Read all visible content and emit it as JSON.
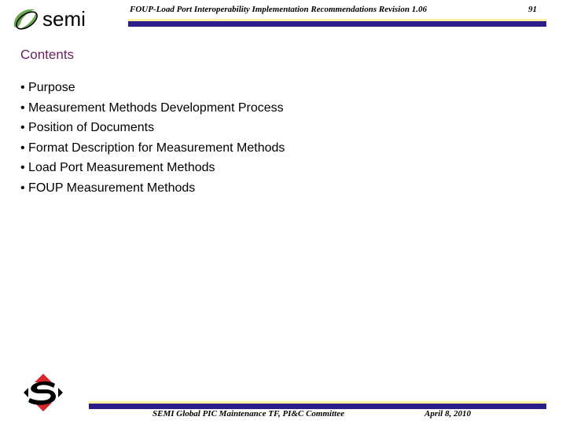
{
  "header": {
    "logo_text": "semi",
    "title": "FOUP-Load Port Interoperability Implementation Recommendations Revision 1.06",
    "page_number": "91"
  },
  "slide": {
    "title": "Contents",
    "bullets": [
      "• Purpose",
      "• Measurement Methods Development Process",
      "• Position of Documents",
      "• Format Description for Measurement Methods",
      "• Load Port Measurement Methods",
      "• FOUP Measurement Methods"
    ]
  },
  "footer": {
    "committee": "SEMI Global PIC Maintenance TF, PI&C Committee",
    "date": "April 8, 2010"
  },
  "colors": {
    "title": "#6b1d5e",
    "bar_blue": "#2b1e8c",
    "bar_yellow": "#fff0a0",
    "logo_green": "#6aa84f"
  },
  "icons": {
    "header_logo": "semi-logo-icon",
    "footer_logo": "semi-s-diamond-icon"
  }
}
